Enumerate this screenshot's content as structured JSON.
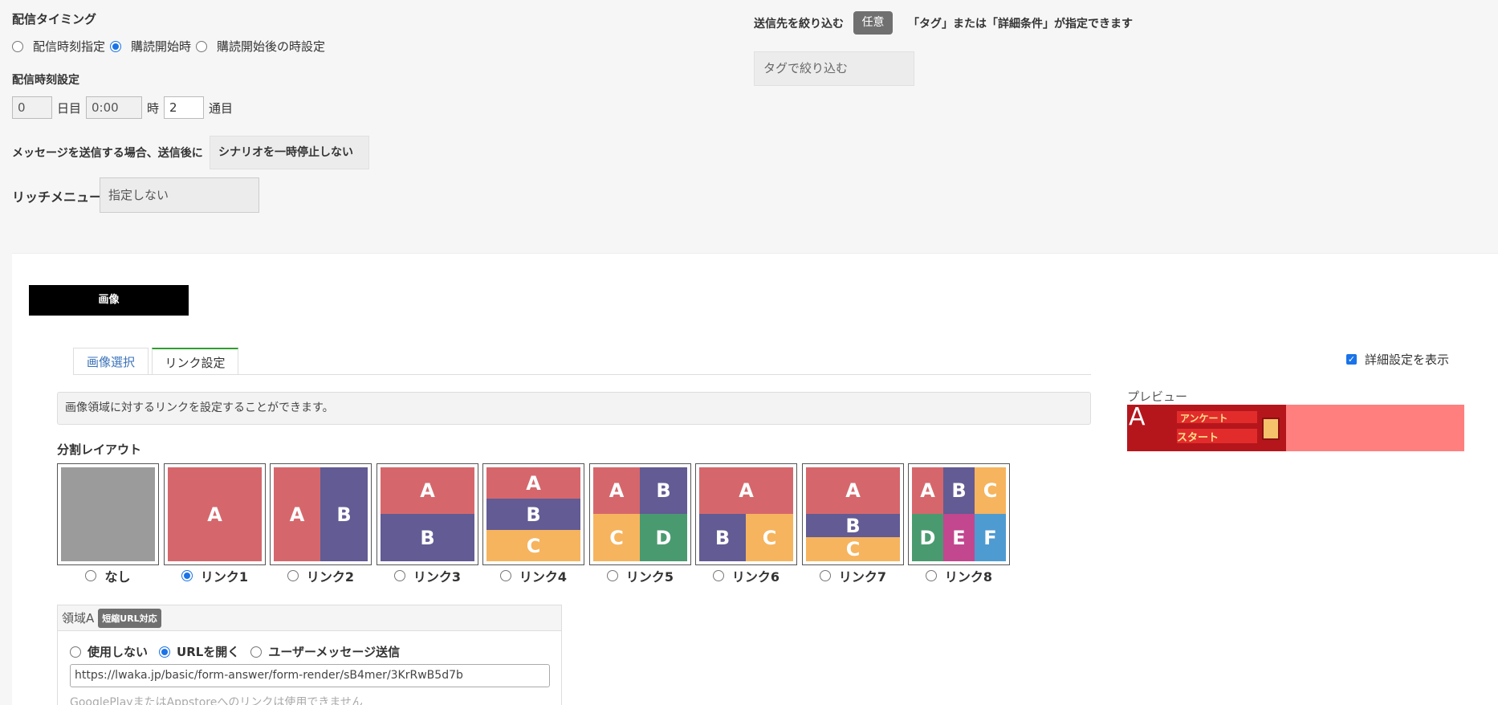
{
  "timing": {
    "title": "配信タイミング",
    "options": [
      "配信時刻指定",
      "購読開始時",
      "購読開始後の時設定"
    ],
    "selected_index": 1
  },
  "time_setting": {
    "title": "配信時刻設定",
    "day_value": "0",
    "day_unit": "日目",
    "time_value": "0:00",
    "time_unit": "時",
    "week_value": "2",
    "week_unit": "通目"
  },
  "after_send": {
    "label": "メッセージを送信する場合、送信後に",
    "value": "シナリオを一時停止しない"
  },
  "rich_menu": {
    "label": "リッチメニュー",
    "value": "指定しない"
  },
  "filter": {
    "label": "送信先を絞り込む",
    "badge": "任意",
    "note": "「タグ」または「詳細条件」が指定できます",
    "tag_placeholder": "タグで絞り込む"
  },
  "image_section": {
    "header_label": "画像",
    "tabs": [
      "画像選択",
      "リンク設定"
    ],
    "active_tab": 1,
    "show_details_label": "詳細設定を表示",
    "show_details_checked": true,
    "info_text": "画像領域に対するリンクを設定することができます。",
    "layout_title": "分割レイアウト",
    "layouts": [
      "なし",
      "リンク1",
      "リンク2",
      "リンク3",
      "リンク4",
      "リンク5",
      "リンク6",
      "リンク7",
      "リンク8"
    ],
    "selected_layout": 1,
    "preview_label": "プレビュー",
    "preview_marker": "A",
    "preview_banner_line1": "アンケート",
    "preview_banner_line2": "スタート"
  },
  "region_a": {
    "title": "領域A",
    "badge": "短縮URL対応",
    "options": [
      "使用しない",
      "URLを開く",
      "ユーザーメッセージ送信"
    ],
    "selected_index": 1,
    "url_value": "https://lwaka.jp/basic/form-answer/form-render/sB4mer/3KrRwB5d7b",
    "note": "GooglePlayまたはAppstoreへのリンクは使用できません"
  },
  "colors": {
    "red": "#d5676c",
    "purple": "#625b94",
    "orange": "#f6b45e",
    "green": "#4a9a70",
    "magenta": "#c2478f",
    "blue": "#4e9bd1",
    "grey": "#9b9b9b",
    "accent": "#1a73e8"
  }
}
